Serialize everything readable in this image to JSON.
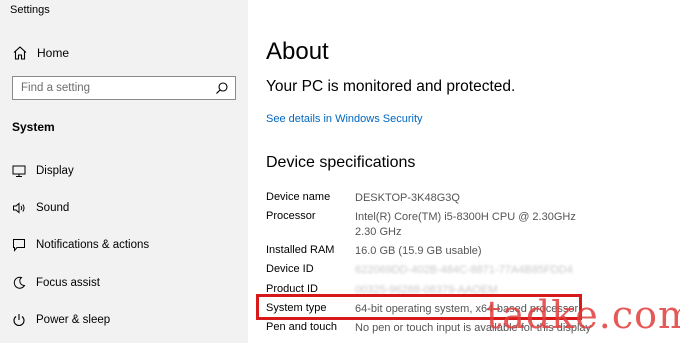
{
  "app": {
    "title": "Settings"
  },
  "sidebar": {
    "home_label": "Home",
    "search_placeholder": "Find a setting",
    "section_label": "System",
    "items": [
      {
        "label": "Display",
        "icon": "display-icon"
      },
      {
        "label": "Sound",
        "icon": "sound-icon"
      },
      {
        "label": "Notifications & actions",
        "icon": "notifications-icon"
      },
      {
        "label": "Focus assist",
        "icon": "focus-assist-icon"
      },
      {
        "label": "Power & sleep",
        "icon": "power-icon"
      }
    ]
  },
  "main": {
    "title": "About",
    "protection_status": "Your PC is monitored and protected.",
    "security_link": "See details in Windows Security",
    "device_specs": {
      "heading": "Device specifications",
      "rows": [
        {
          "label": "Device name",
          "value": "DESKTOP-3K48G3Q"
        },
        {
          "label": "Processor",
          "value": "Intel(R) Core(TM) i5-8300H CPU @ 2.30GHz   2.30 GHz"
        },
        {
          "label": "Installed RAM",
          "value": "16.0 GB (15.9 GB usable)"
        },
        {
          "label": "Device ID",
          "value": "622069DD-402B-484C-8871-77A4B85FDD4"
        },
        {
          "label": "Product ID",
          "value": "00325-96288-08379-AAOEM"
        },
        {
          "label": "System type",
          "value": "64-bit operating system, x64-based processor"
        },
        {
          "label": "Pen and touch",
          "value": "No pen or touch input is available for this display"
        }
      ]
    }
  },
  "watermark": {
    "text": "tadke.com"
  },
  "colors": {
    "sidebar_bg": "#f2f2f2",
    "link": "#0067c0",
    "highlight_border": "#d71919"
  }
}
